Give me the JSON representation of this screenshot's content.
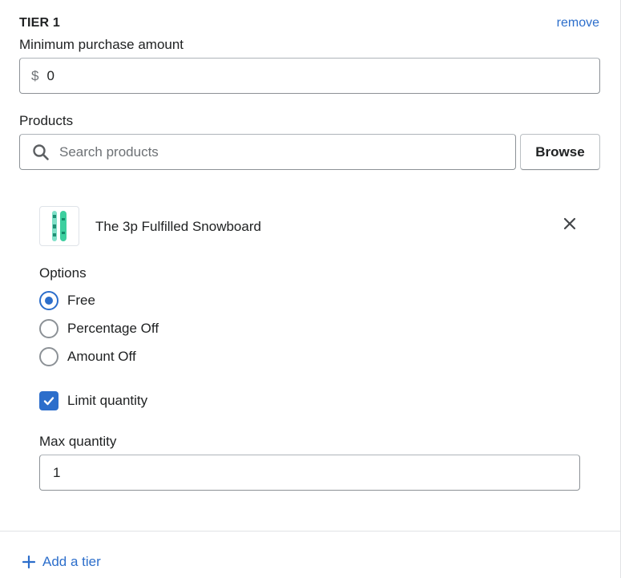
{
  "tier": {
    "title": "TIER 1",
    "remove_label": "remove"
  },
  "min_purchase": {
    "label": "Minimum purchase amount",
    "prefix": "$",
    "value": "0"
  },
  "products": {
    "label": "Products",
    "search_placeholder": "Search products",
    "browse_label": "Browse",
    "selected": {
      "name": "The 3p Fulfilled Snowboard",
      "thumbnail_icon": "snowboard-icon"
    }
  },
  "options": {
    "label": "Options",
    "choices": [
      {
        "label": "Free",
        "selected": true
      },
      {
        "label": "Percentage Off",
        "selected": false
      },
      {
        "label": "Amount Off",
        "selected": false
      }
    ]
  },
  "limit_quantity": {
    "label": "Limit quantity",
    "checked": true
  },
  "max_quantity": {
    "label": "Max quantity",
    "value": "1"
  },
  "footer": {
    "add_tier_label": "Add a tier"
  },
  "colors": {
    "accent": "#2c6ecb",
    "text": "#202223",
    "muted": "#6d7175",
    "border": "#8c9196"
  }
}
